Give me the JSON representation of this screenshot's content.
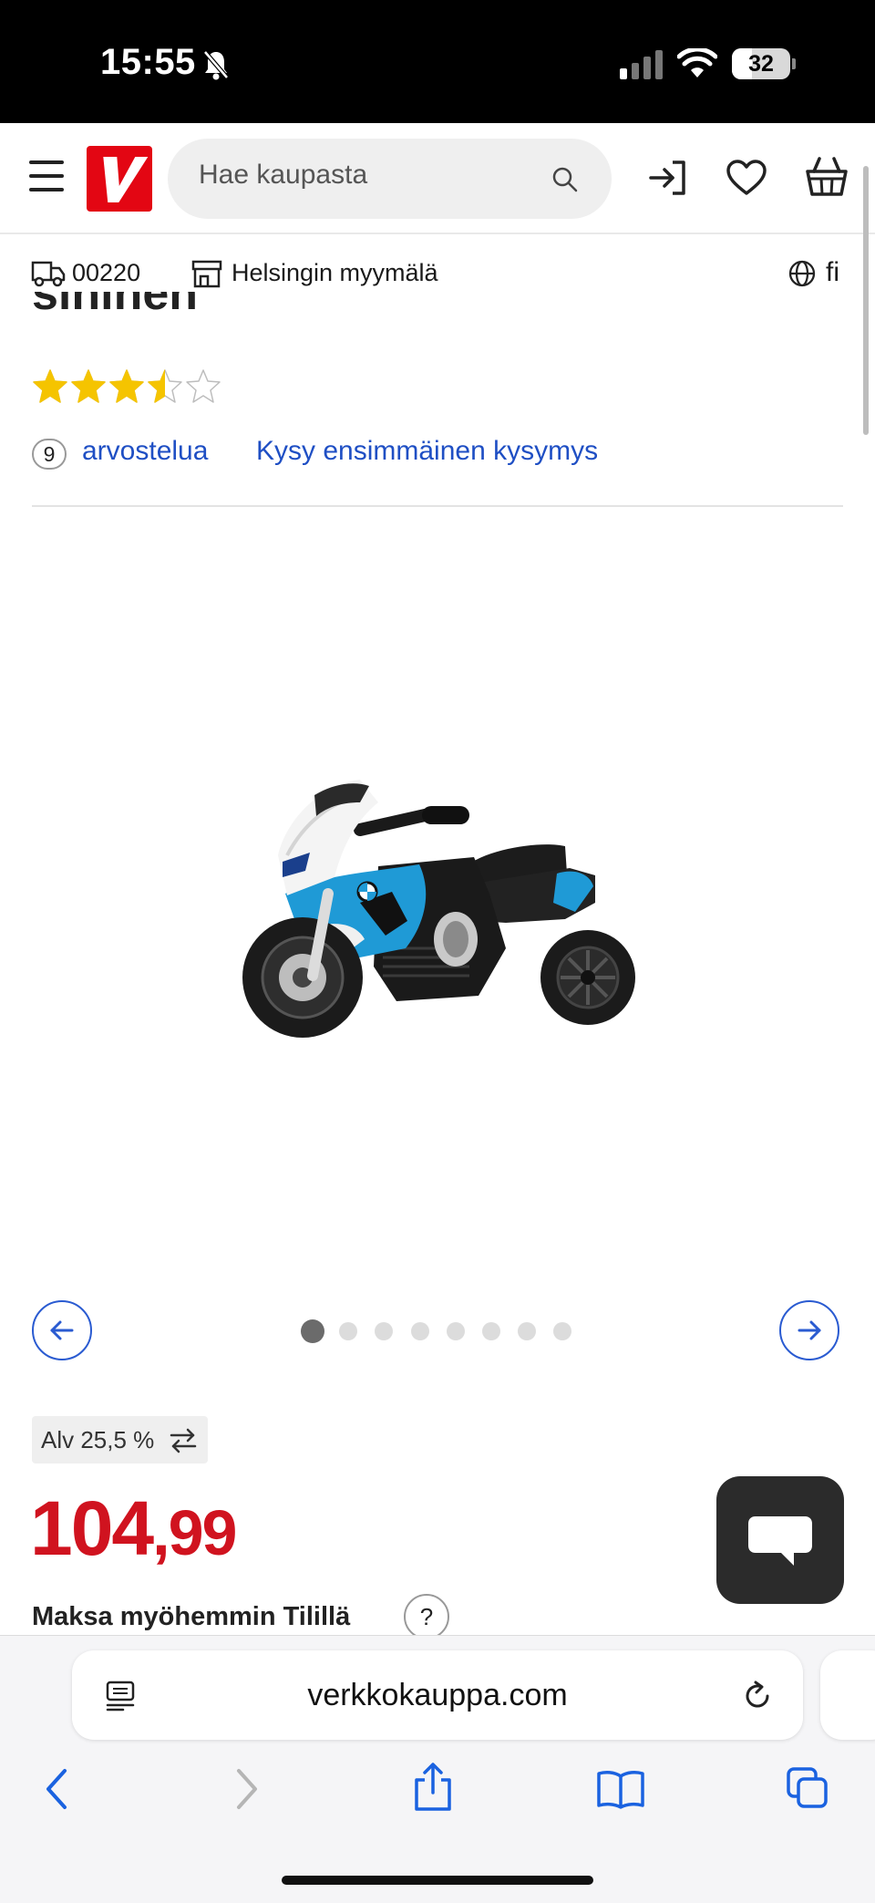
{
  "status_bar": {
    "time": "15:55",
    "battery": "32"
  },
  "header": {
    "logo_letter": "V",
    "search_placeholder": "Hae kaupasta"
  },
  "location_bar": {
    "postal_code": "00220",
    "store": "Helsingin myymälä",
    "language": "fi"
  },
  "product": {
    "title_fragment": "sininen",
    "rating": 3.5,
    "rating_max": 5,
    "review_count": "9",
    "reviews_label": "arvostelua",
    "ask_question": "Kysy ensimmäinen kysymys",
    "image_alt": "Lasten sähkömoottoripyörä BMW, sininen",
    "gallery_dots": 8,
    "gallery_active_index": 0,
    "vat_label": "Alv 25,5 %",
    "price_main": "104",
    "price_cents": ",99",
    "pay_later": "Maksa myöhemmin Tilillä",
    "help_mark": "?"
  },
  "safari": {
    "url": "verkkokauppa.com"
  },
  "colors": {
    "brand_red": "#e30613",
    "link_blue": "#1f4fc4",
    "price_red": "#d0131f",
    "star_yellow": "#f5c400",
    "product_blue": "#1f9ad6"
  }
}
